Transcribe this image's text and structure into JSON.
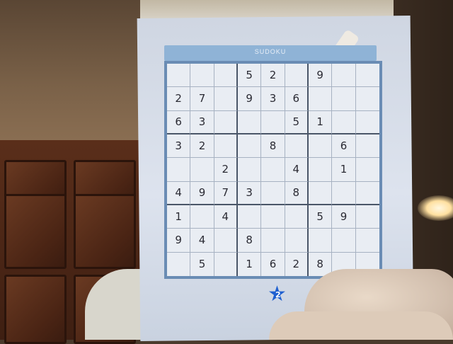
{
  "puzzle": {
    "title": "SUDOKU",
    "grid": [
      [
        "",
        "",
        "",
        "5",
        "2",
        "",
        "9",
        "",
        ""
      ],
      [
        "2",
        "7",
        "",
        "9",
        "3",
        "6",
        "",
        "",
        ""
      ],
      [
        "6",
        "3",
        "",
        "",
        "",
        "5",
        "1",
        "",
        ""
      ],
      [
        "3",
        "2",
        "",
        "",
        "8",
        "",
        "",
        "6",
        ""
      ],
      [
        "",
        "",
        "2",
        "",
        "",
        "4",
        "",
        "1",
        ""
      ],
      [
        "4",
        "9",
        "7",
        "3",
        "",
        "8",
        "",
        "",
        ""
      ],
      [
        "1",
        "",
        "4",
        "",
        "",
        "",
        "5",
        "9",
        ""
      ],
      [
        "9",
        "4",
        "",
        "8",
        "",
        "",
        "",
        "",
        ""
      ],
      [
        "",
        "5",
        "",
        "1",
        "6",
        "2",
        "8",
        "",
        ""
      ]
    ],
    "difficulty_star_number": "2"
  },
  "colors": {
    "banner": "#8fb3d6",
    "frame": "#6a8cb4",
    "star": "#1e5fd0"
  }
}
